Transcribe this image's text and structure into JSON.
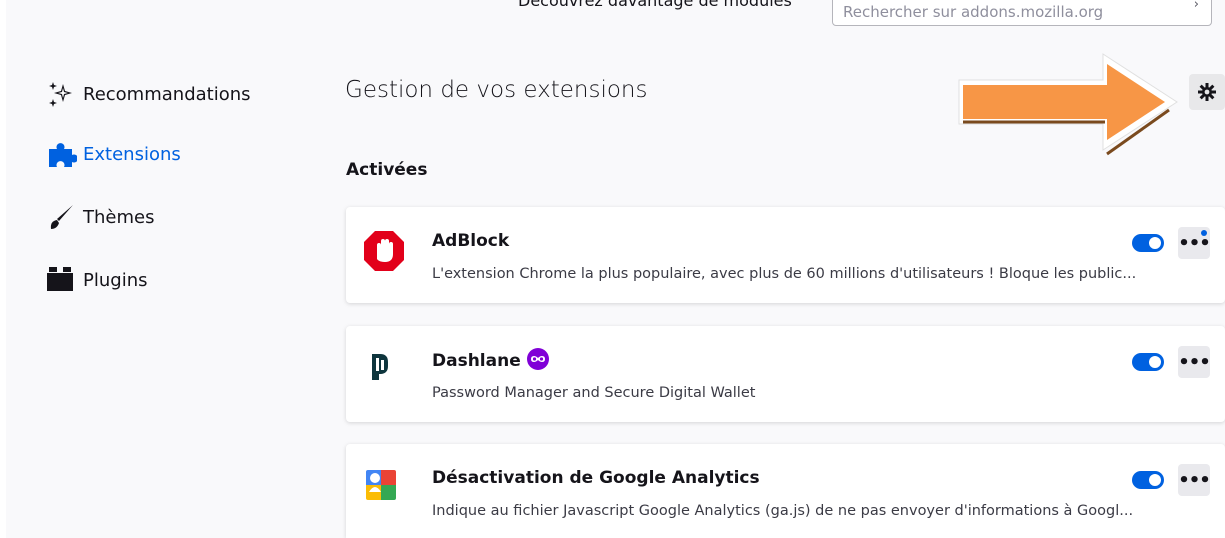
{
  "header": {
    "discover_label": "Découvrez davantage de modules",
    "search_placeholder": "Rechercher sur addons.mozilla.org"
  },
  "sidebar": {
    "items": [
      {
        "label": "Recommandations",
        "icon": "sparkle-icon"
      },
      {
        "label": "Extensions",
        "icon": "puzzle-icon",
        "active": true
      },
      {
        "label": "Thèmes",
        "icon": "brush-icon"
      },
      {
        "label": "Plugins",
        "icon": "plugin-block-icon"
      }
    ]
  },
  "main": {
    "title": "Gestion de vos extensions",
    "section_heading": "Activées",
    "extensions": [
      {
        "name": "AdBlock",
        "description": "L'extension Chrome la plus populaire, avec plus de 60 millions d'utilisateurs ! Bloque les public...",
        "enabled": true,
        "icon": "adblock-hand-icon"
      },
      {
        "name": "Dashlane",
        "description": "Password Manager and Secure Digital Wallet",
        "enabled": true,
        "icon": "dashlane-icon"
      },
      {
        "name": "Désactivation de Google Analytics",
        "description": "Indique au fichier Javascript Google Analytics (ga.js) de ne pas envoyer d'informations à Googl...",
        "enabled": true,
        "icon": "google-analytics-optout-icon"
      }
    ]
  },
  "colors": {
    "accent": "#0061e0",
    "annotation_arrow": "#f79646",
    "private_badge": "#8000d7"
  }
}
